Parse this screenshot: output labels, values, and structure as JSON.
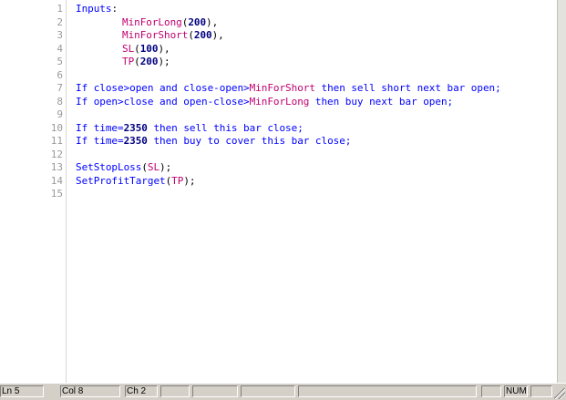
{
  "editor": {
    "lines": [
      {
        "num": "1",
        "segs": [
          {
            "t": "Inputs",
            "c": "kw"
          },
          {
            "t": ":",
            "c": "pun"
          }
        ]
      },
      {
        "num": "2",
        "indent": true,
        "segs": [
          {
            "t": "MinForLong",
            "c": "var"
          },
          {
            "t": "(",
            "c": "pun"
          },
          {
            "t": "200",
            "c": "num"
          },
          {
            "t": "),",
            "c": "pun"
          }
        ]
      },
      {
        "num": "3",
        "indent": true,
        "segs": [
          {
            "t": "MinForShort",
            "c": "var"
          },
          {
            "t": "(",
            "c": "pun"
          },
          {
            "t": "200",
            "c": "num"
          },
          {
            "t": "),",
            "c": "pun"
          }
        ]
      },
      {
        "num": "4",
        "indent": true,
        "segs": [
          {
            "t": "SL",
            "c": "var"
          },
          {
            "t": "(",
            "c": "pun"
          },
          {
            "t": "100",
            "c": "num"
          },
          {
            "t": "),",
            "c": "pun"
          }
        ]
      },
      {
        "num": "5",
        "indent": true,
        "segs": [
          {
            "t": "TP",
            "c": "var"
          },
          {
            "t": "(",
            "c": "pun"
          },
          {
            "t": "200",
            "c": "num"
          },
          {
            "t": ");",
            "c": "pun"
          }
        ]
      },
      {
        "num": "6",
        "segs": []
      },
      {
        "num": "7",
        "segs": [
          {
            "t": "If close>open and close-open>",
            "c": "kw"
          },
          {
            "t": "MinForShort",
            "c": "var"
          },
          {
            "t": " then sell short next bar open;",
            "c": "kw"
          }
        ]
      },
      {
        "num": "8",
        "segs": [
          {
            "t": "If open>close and open-close>",
            "c": "kw"
          },
          {
            "t": "MinForLong",
            "c": "var"
          },
          {
            "t": " then buy next bar open;",
            "c": "kw"
          }
        ]
      },
      {
        "num": "9",
        "segs": []
      },
      {
        "num": "10",
        "segs": [
          {
            "t": "If time=",
            "c": "kw"
          },
          {
            "t": "2350",
            "c": "num"
          },
          {
            "t": " then sell this bar close;",
            "c": "kw"
          }
        ]
      },
      {
        "num": "11",
        "segs": [
          {
            "t": "If time=",
            "c": "kw"
          },
          {
            "t": "2350",
            "c": "num"
          },
          {
            "t": " then buy to cover this bar close;",
            "c": "kw"
          }
        ]
      },
      {
        "num": "12",
        "segs": []
      },
      {
        "num": "13",
        "segs": [
          {
            "t": "SetStopLoss",
            "c": "kw"
          },
          {
            "t": "(",
            "c": "pun"
          },
          {
            "t": "SL",
            "c": "var"
          },
          {
            "t": ");",
            "c": "pun"
          }
        ]
      },
      {
        "num": "14",
        "segs": [
          {
            "t": "SetProfitTarget",
            "c": "kw"
          },
          {
            "t": "(",
            "c": "pun"
          },
          {
            "t": "TP",
            "c": "var"
          },
          {
            "t": ");",
            "c": "pun"
          }
        ]
      },
      {
        "num": "15",
        "segs": []
      }
    ]
  },
  "status": {
    "ln": "Ln 5",
    "col": "Col 8",
    "ch": "Ch 2",
    "num": "NUM"
  },
  "colors": {
    "keyword": "#0000ff",
    "variable": "#c00070",
    "number": "#000080"
  }
}
